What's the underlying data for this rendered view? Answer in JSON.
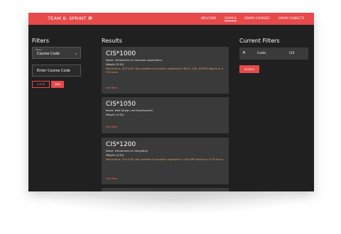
{
  "header": {
    "brand": "TEAM 8: SPRINT 9",
    "theme_icon": "sun-icon",
    "nav": [
      {
        "label": "WELCOME",
        "active": false
      },
      {
        "label": "SEARCH",
        "active": true
      },
      {
        "label": "GRAPH COURSES",
        "active": false
      },
      {
        "label": "GRAPH SUBJECTS",
        "active": false
      }
    ]
  },
  "filters": {
    "title": "Filters",
    "select_label": "Filters",
    "select_value": "Course Code",
    "input_value": "Enter Course Code",
    "clear_label": "CLEAR",
    "add_label": "ADD"
  },
  "results": {
    "title": "Results",
    "cards": [
      {
        "code": "CIS*1000",
        "name": "Name: Introduction to Computer Applications",
        "weight": "Weight: [0.50]",
        "restriction": "Restrictions: CIS*1000. Not available to students registered in BACS, AML, BCOMP degree or a CIS minor.",
        "more": "See More"
      },
      {
        "code": "CIS*1050",
        "name": "Name: Web Design and Development",
        "weight": "Weight: [0.50]",
        "restriction": "",
        "more": "See More"
      },
      {
        "code": "CIS*1200",
        "name": "Name: Introduction to Computing",
        "weight": "Weight: [0.50]",
        "restriction": "Restrictions: CIS*1200. Not available to students registered in a BCOMP degree or a CIS minor.",
        "more": "See More"
      }
    ]
  },
  "current_filters": {
    "title": "Current Filters",
    "rows": [
      {
        "key": "Code:",
        "value": "CIS"
      }
    ],
    "search_label": "SEARCH"
  },
  "colors": {
    "accent": "#e64a4a",
    "background": "#202020",
    "card": "#3a3a3a",
    "warning": "#e0a060"
  }
}
